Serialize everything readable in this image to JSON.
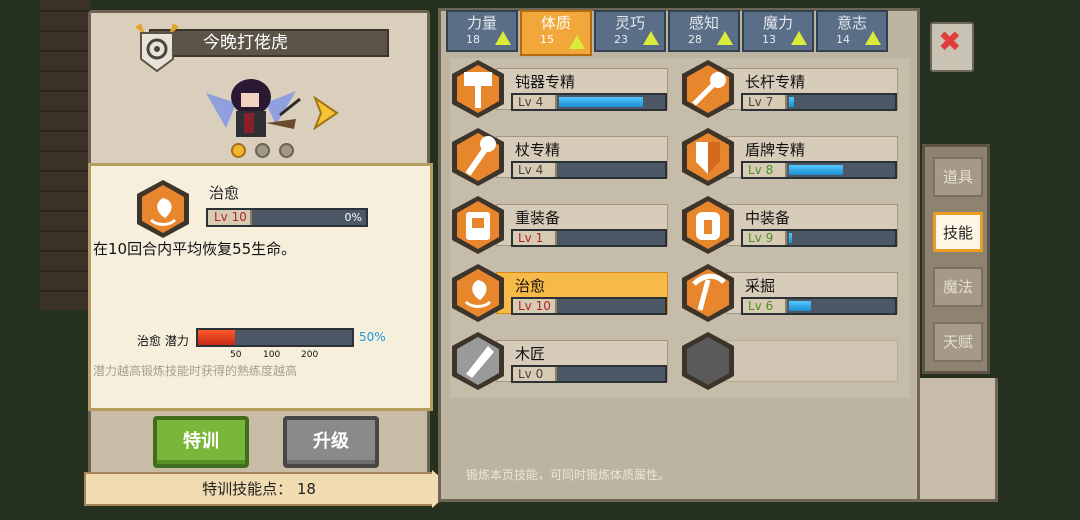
{
  "character": {
    "name": "今晚打佬虎",
    "page_dots": 3,
    "active_dot": 0
  },
  "detail": {
    "skill_name": "治愈",
    "level": "Lv 10",
    "progress_pct": "0%",
    "description": "在10回合内平均恢复55生命。",
    "potential_label": "治愈 潜力",
    "potential_pct": "50%",
    "potential_fraction": 0.24,
    "ticks": [
      "50",
      "100",
      "200"
    ],
    "potential_note": "潜力越高锻炼技能时获得的熟练度越高"
  },
  "buttons": {
    "train": "特训",
    "upgrade": "升级"
  },
  "train_points": "特训技能点： 18",
  "attribute_tabs": [
    {
      "name": "力量",
      "value": "18"
    },
    {
      "name": "体质",
      "value": "15"
    },
    {
      "name": "灵巧",
      "value": "23"
    },
    {
      "name": "感知",
      "value": "28"
    },
    {
      "name": "魔力",
      "value": "13"
    },
    {
      "name": "意志",
      "value": "14"
    }
  ],
  "active_tab": 1,
  "side_nav": [
    "道具",
    "技能",
    "魔法",
    "天赋"
  ],
  "active_side": 1,
  "skills": [
    {
      "name": "钝器专精",
      "level": "Lv 4",
      "fill": 0.78,
      "lv_color": "dark",
      "icon": "hammer-icon"
    },
    {
      "name": "长杆专精",
      "level": "Lv 7",
      "fill": 0.05,
      "lv_color": "dark",
      "icon": "halberd-icon"
    },
    {
      "name": "杖专精",
      "level": "Lv 4",
      "fill": 0.0,
      "lv_color": "dark",
      "icon": "staff-icon"
    },
    {
      "name": "盾牌专精",
      "level": "Lv 8",
      "fill": 0.5,
      "lv_color": "green",
      "icon": "shield-icon"
    },
    {
      "name": "重装备",
      "level": "Lv 1",
      "fill": 0.0,
      "lv_color": "red",
      "icon": "heavy-armor-icon"
    },
    {
      "name": "中装备",
      "level": "Lv 9",
      "fill": 0.03,
      "lv_color": "green",
      "icon": "medium-armor-icon"
    },
    {
      "name": "治愈",
      "level": "Lv 10",
      "fill": 0.0,
      "lv_color": "red",
      "icon": "heal-leaf-icon",
      "selected": true
    },
    {
      "name": "采掘",
      "level": "Lv 6",
      "fill": 0.2,
      "lv_color": "green",
      "icon": "pickaxe-icon"
    },
    {
      "name": "木匠",
      "level": "Lv 0",
      "fill": 0.0,
      "lv_color": "dark",
      "icon": "saw-icon"
    }
  ],
  "footer_note": "锻炼本页技能，可同时锻炼体质属性。",
  "colors": {
    "accent": "#f2a73b",
    "tab_blue": "#5a6f87",
    "bar_blue": "#1b8ed0",
    "potential_red": "#e0401f",
    "train_green": "#7ab63a"
  }
}
